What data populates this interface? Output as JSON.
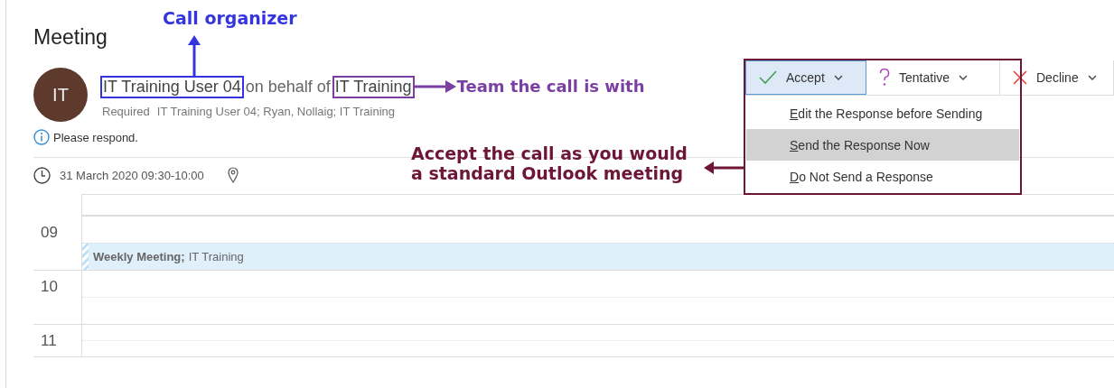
{
  "title": "Meeting",
  "organizer": {
    "avatar_initials": "IT",
    "name": "IT Training User 04",
    "on_behalf_text": "on behalf of",
    "delegate": "IT Training"
  },
  "required": {
    "label": "Required",
    "attendees": "IT Training User 04; Ryan, Nollaig; IT Training"
  },
  "info": "Please respond.",
  "when": "31 March 2020 09:30-10:00",
  "response_buttons": [
    {
      "kind": "accept",
      "label": "Accept",
      "selected": true
    },
    {
      "kind": "tentative",
      "label": "Tentative",
      "selected": false
    },
    {
      "kind": "decline",
      "label": "Decline",
      "selected": false
    }
  ],
  "response_menu": [
    {
      "label": "Edit the Response before Sending",
      "selected": false
    },
    {
      "label": "Send the Response Now",
      "selected": true
    },
    {
      "label": "Do Not Send a Response",
      "selected": false
    }
  ],
  "calendar": {
    "hours": [
      "09",
      "10",
      "11"
    ],
    "event": {
      "title": "Weekly Meeting;",
      "location": "IT Training"
    }
  },
  "annotations": [
    {
      "kind": "organizer",
      "text": "Call organizer"
    },
    {
      "kind": "team",
      "text": "Team the call is with"
    },
    {
      "kind": "accept",
      "text": "Accept the call as you would\na standard Outlook meeting"
    }
  ]
}
